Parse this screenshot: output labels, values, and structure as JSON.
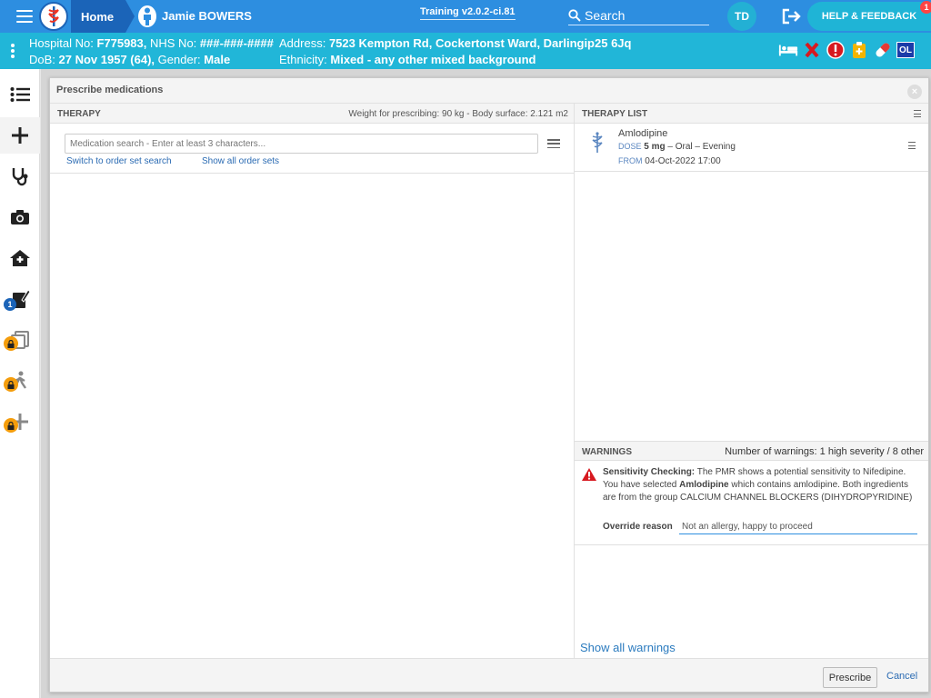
{
  "topbar": {
    "home_label": "Home",
    "patient_name": "Jamie BOWERS",
    "version": "Training v2.0.2-ci.81",
    "search_label": "Search",
    "user_initials": "TD",
    "help_label": "HELP & FEEDBACK",
    "help_badge": "1",
    "colors": {
      "bar": "#2d8ee0",
      "home": "#1b64b8",
      "accent": "#1fb4d6"
    }
  },
  "patient": {
    "hospital_label": "Hospital No:",
    "hospital_no": "F775983,",
    "nhs_label": "NHS No:",
    "nhs_no": "###-###-####",
    "address_label": "Address:",
    "address": "7523 Kempton Rd, Cockertonst Ward, Darlingip25 6Jq",
    "dob_label": "DoB:",
    "dob": "27 Nov 1957 (64),",
    "gender_label": "Gender:",
    "gender": "Male",
    "ethnicity_label": "Ethnicity:",
    "ethnicity": "Mixed - any other mixed background",
    "alert_icons": [
      "bed-icon",
      "cross-icon",
      "exclamation-icon",
      "clipboard-icon",
      "pill-icon"
    ],
    "ol_label": "OL"
  },
  "leftnav": {
    "items": [
      "list-icon",
      "plus-icon",
      "stethoscope-icon",
      "camera-icon",
      "home-care-icon",
      "prescription-edit-icon",
      "documents-icon",
      "walking-icon",
      "add-icon"
    ],
    "count_badge": "1"
  },
  "modal": {
    "title": "Prescribe medications",
    "therapy": {
      "label": "THERAPY",
      "weight_info": "Weight for prescribing: 90 kg - Body surface: 2.121 m2",
      "search_placeholder": "Medication search - Enter at least 3 characters...",
      "link_order_set": "Switch to order set search",
      "link_show_all": "Show all order sets"
    },
    "therapy_list": {
      "label": "THERAPY LIST",
      "items": [
        {
          "name": "Amlodipine",
          "dose_label": "DOSE",
          "dose_amount": "5 mg",
          "dose_detail": "– Oral – Evening",
          "from_label": "FROM",
          "from_value": "04-Oct-2022 17:00"
        }
      ]
    },
    "warnings": {
      "label": "WARNINGS",
      "count_text": "Number of warnings: 1 high severity / 8 other",
      "title": "Sensitivity Checking:",
      "text_a": "The PMR shows a potential sensitivity to Nifedipine. You have selected",
      "drug": "Amlodipine",
      "text_b": "which contains amlodipine. Both ingredients are from the group CALCIUM CHANNEL BLOCKERS (DIHYDROPYRIDINE)",
      "override_label": "Override reason",
      "override_value": "Not an allergy, happy to proceed",
      "show_all": "Show all warnings"
    },
    "footer": {
      "prescribe_label": "Prescribe",
      "cancel_label": "Cancel"
    }
  }
}
